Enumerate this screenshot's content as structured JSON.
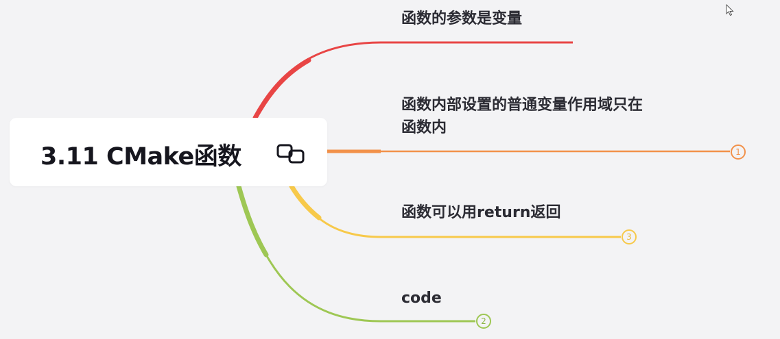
{
  "root": {
    "title": "3.11 CMake函数",
    "link_icon": "link-icon"
  },
  "topics": [
    {
      "text": "函数的参数是变量",
      "color": "#e84545"
    },
    {
      "text": "函数内部设置的普通变量作用域只在",
      "text_line2": "函数内",
      "color": "#f2914a",
      "badge": "1"
    },
    {
      "text": "函数可以用return返回",
      "color": "#f7c94a",
      "badge": "3"
    },
    {
      "text": "code",
      "color": "#9ec754",
      "badge": "2"
    }
  ]
}
